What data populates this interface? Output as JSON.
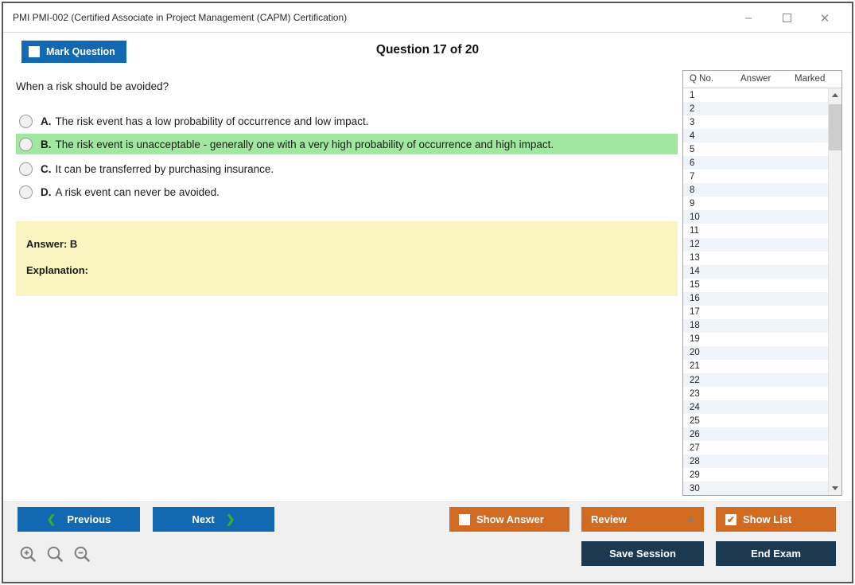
{
  "window": {
    "title": "PMI PMI-002 (Certified Associate in Project Management (CAPM) Certification)"
  },
  "titlebar_controls": {
    "minimize": "–",
    "close": "✕"
  },
  "header": {
    "mark_question_label": "Mark Question",
    "mark_question_checked": false,
    "question_counter": "Question 17 of 20"
  },
  "question": {
    "text": "When a risk should be avoided?",
    "options": [
      {
        "letter": "A.",
        "text": "The risk event has a low probability of occurrence and low impact.",
        "highlighted": false
      },
      {
        "letter": "B.",
        "text": "The risk event is unacceptable - generally one with a very high probability of occurrence and high impact.",
        "highlighted": true
      },
      {
        "letter": "C.",
        "text": "It can be transferred by purchasing insurance.",
        "highlighted": false
      },
      {
        "letter": "D.",
        "text": "A risk event can never be avoided.",
        "highlighted": false
      }
    ],
    "answer_label": "Answer: B",
    "explanation_label": "Explanation:"
  },
  "question_list": {
    "columns": [
      "Q No.",
      "Answer",
      "Marked"
    ],
    "rows": [
      1,
      2,
      3,
      4,
      5,
      6,
      7,
      8,
      9,
      10,
      11,
      12,
      13,
      14,
      15,
      16,
      17,
      18,
      19,
      20,
      21,
      22,
      23,
      24,
      25,
      26,
      27,
      28,
      29,
      30
    ]
  },
  "footer": {
    "previous_label": "Previous",
    "next_label": "Next",
    "show_answer_label": "Show Answer",
    "show_answer_checked": false,
    "review_label": "Review",
    "show_list_label": "Show List",
    "show_list_checked": true,
    "save_session_label": "Save Session",
    "end_exam_label": "End Exam"
  },
  "icons": {
    "previous_chevron": "❮",
    "next_chevron": "❯",
    "review_caret": "▲",
    "checkmark": "✔"
  },
  "colors": {
    "accent_blue": "#1268B1",
    "accent_orange": "#D26B22",
    "accent_navy": "#1B3A52",
    "highlight_green": "#A0E8A0",
    "answer_yellow": "#FAF4C0",
    "stripe_blue": "#EFF4FA",
    "chevron_green": "#3BAE2B"
  }
}
